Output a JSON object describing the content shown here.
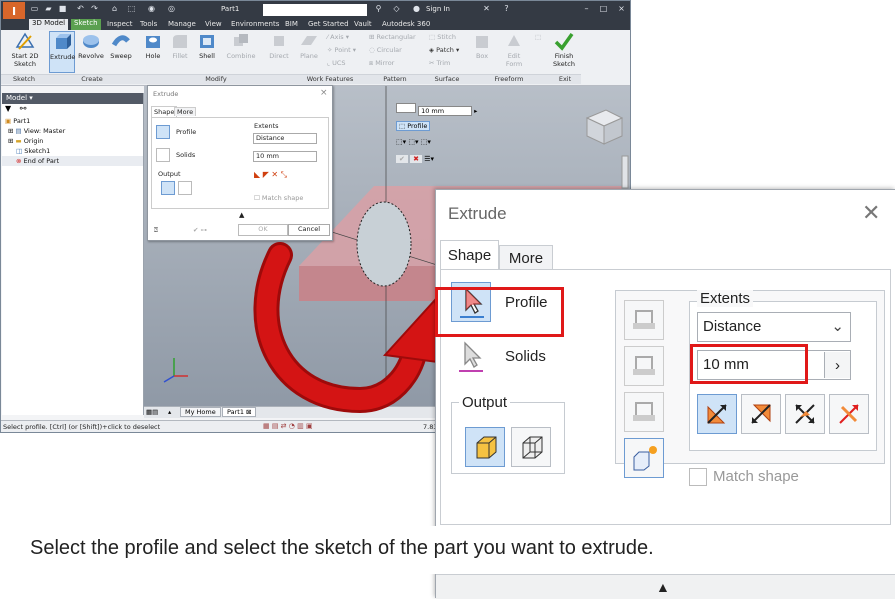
{
  "app": {
    "window_title": "Part1",
    "logo_letter": "I",
    "logo_sub": "PRO",
    "sign_in": "Sign In",
    "menus": [
      "3D Model",
      "Sketch",
      "Inspect",
      "Tools",
      "Manage",
      "View",
      "Environments",
      "BIM",
      "Get Started",
      "Vault",
      "Autodesk 360"
    ]
  },
  "ribbon": {
    "start_sketch": "Start 2D Sketch",
    "extrude": "Extrude",
    "revolve": "Revolve",
    "sweep": "Sweep",
    "hole": "Hole",
    "fillet": "Fillet",
    "shell": "Shell",
    "combine": "Combine",
    "direct": "Direct",
    "plane": "Plane",
    "axis": "Axis",
    "point": "Point",
    "ucs": "UCS",
    "rectangular": "Rectangular",
    "circular": "Circular",
    "mirror": "Mirror",
    "stitch": "Stitch",
    "patch": "Patch",
    "trim": "Trim",
    "box": "Box",
    "edit_form": "Edit Form",
    "finish_sketch": "Finish Sketch",
    "groups": {
      "sketch": "Sketch",
      "create": "Create",
      "modify": "Modify",
      "work_features": "Work Features",
      "pattern": "Pattern",
      "surface": "Surface",
      "freeform": "Freeform",
      "exit": "Exit"
    }
  },
  "browser": {
    "header": "Model",
    "items": [
      "Part1",
      "View: Master",
      "Origin",
      "Sketch1",
      "End of Part"
    ]
  },
  "minibar": {
    "distance": "10 mm",
    "profile": "Profile"
  },
  "small_dialog": {
    "title": "Extrude",
    "tabs": [
      "Shape",
      "More"
    ],
    "profile": "Profile",
    "solids": "Solids",
    "output": "Output",
    "extents": "Extents",
    "extent_type": "Distance",
    "distance": "10 mm",
    "match_shape": "Match shape",
    "ok": "OK",
    "cancel": "Cancel"
  },
  "tabs_bottom": {
    "my_home": "My Home",
    "part1": "Part1"
  },
  "status": {
    "text": "Select profile. [Ctrl] (or [Shift])+click to deselect",
    "value": "7.83"
  },
  "zoom_dialog": {
    "title": "Extrude",
    "tabs": [
      "Shape",
      "More"
    ],
    "profile": "Profile",
    "solids": "Solids",
    "output": "Output",
    "extents": "Extents",
    "extent_type": "Distance",
    "distance": "10 mm",
    "match_shape": "Match shape"
  },
  "caption": "Select the profile and select the sketch of the part you want to extrude.",
  "colors": {
    "highlight": "#e01818",
    "arrow_red": "#d41414",
    "part_pink": "#d9a0a6",
    "selected_blue": "#cfe3f7"
  }
}
